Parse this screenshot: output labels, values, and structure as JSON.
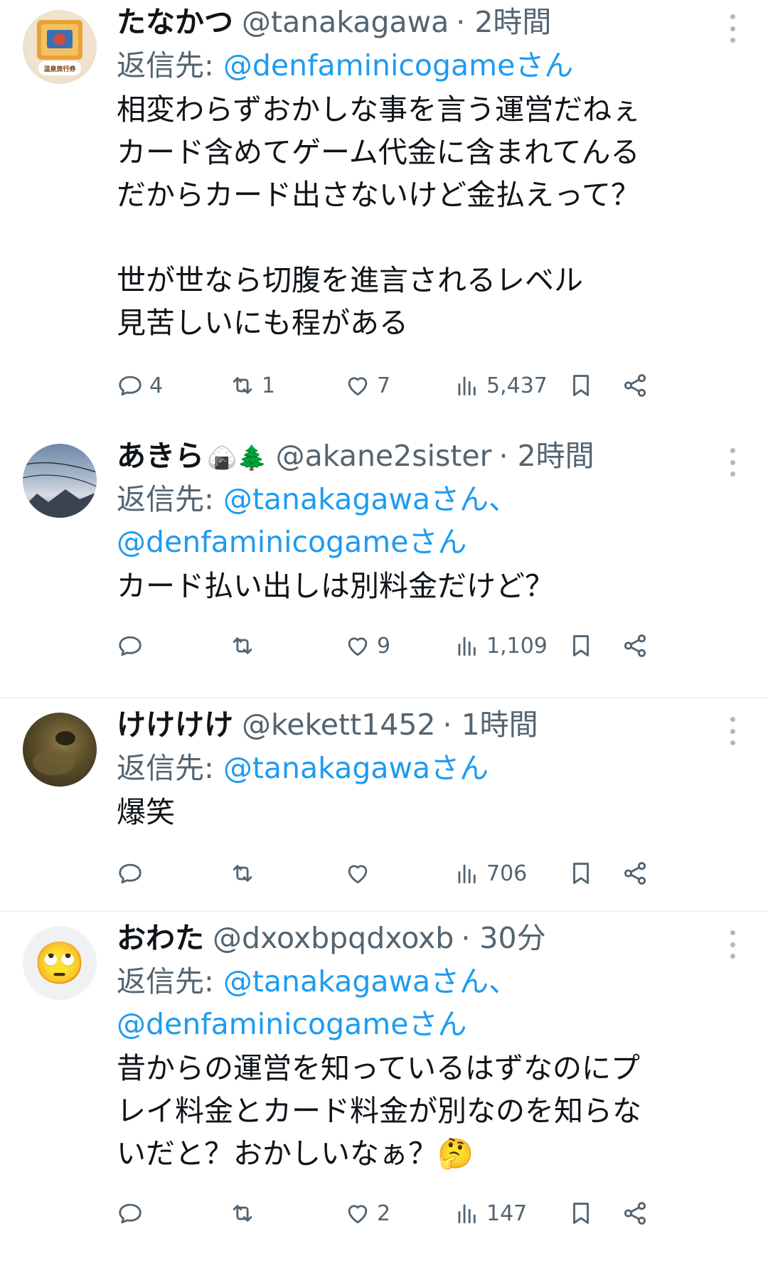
{
  "replies": [
    {
      "name": "たなかつ",
      "name_emoji": "",
      "handle": "@tanakagawa",
      "time": "· 2時間",
      "reply_label": "返信先: ",
      "mentions_line1": "@denfaminicogameさん",
      "mentions_line2": "",
      "text": "相変わらずおかしな事を言う運営だねぇ\nカード含めてゲーム代金に含まれてんる\nだからカード出さないけど金払えって？\n\n世が世なら切腹を進言されるレベル\n見苦しいにも程がある",
      "avatar_text": "温泉旅行券",
      "stats": {
        "replies": "4",
        "retweets": "1",
        "likes": "7",
        "views": "5,437"
      }
    },
    {
      "name": "あきら",
      "name_emoji": "🍙🌲",
      "handle": "@akane2sister",
      "time": "· 2時間",
      "reply_label": "返信先: ",
      "mentions_line1": "@tanakagawaさん、",
      "mentions_line2": "@denfaminicogameさん",
      "text": "カード払い出しは別料金だけど？",
      "avatar_text": "",
      "stats": {
        "replies": "",
        "retweets": "",
        "likes": "9",
        "views": "1,109"
      }
    },
    {
      "name": "けけけけ",
      "name_emoji": "",
      "handle": "@kekett1452",
      "time": "· 1時間",
      "reply_label": "返信先: ",
      "mentions_line1": "@tanakagawaさん",
      "mentions_line2": "",
      "text": "爆笑",
      "avatar_text": "",
      "stats": {
        "replies": "",
        "retweets": "",
        "likes": "",
        "views": "706"
      }
    },
    {
      "name": "おわた",
      "name_emoji": "",
      "handle": "@dxoxbpqdxoxb",
      "time": "· 30分",
      "reply_label": "返信先: ",
      "mentions_line1": "@tanakagawaさん、",
      "mentions_line2": "@denfaminicogameさん",
      "text": "昔からの運営を知っているはずなのにプ\nレイ料金とカード料金が別なのを知らな\nいだと？おかしいなぁ？🤔",
      "avatar_text": "🙄",
      "stats": {
        "replies": "",
        "retweets": "",
        "likes": "2",
        "views": "147"
      }
    }
  ],
  "icons": {
    "reply": "comment-icon",
    "retweet": "retweet-icon",
    "like": "heart-icon",
    "views": "views-icon",
    "bookmark": "bookmark-icon",
    "share": "share-icon",
    "more": "more-icon"
  },
  "colors": {
    "link": "#1d9bf0",
    "secondary": "#536471",
    "divider": "#eff3f4"
  }
}
